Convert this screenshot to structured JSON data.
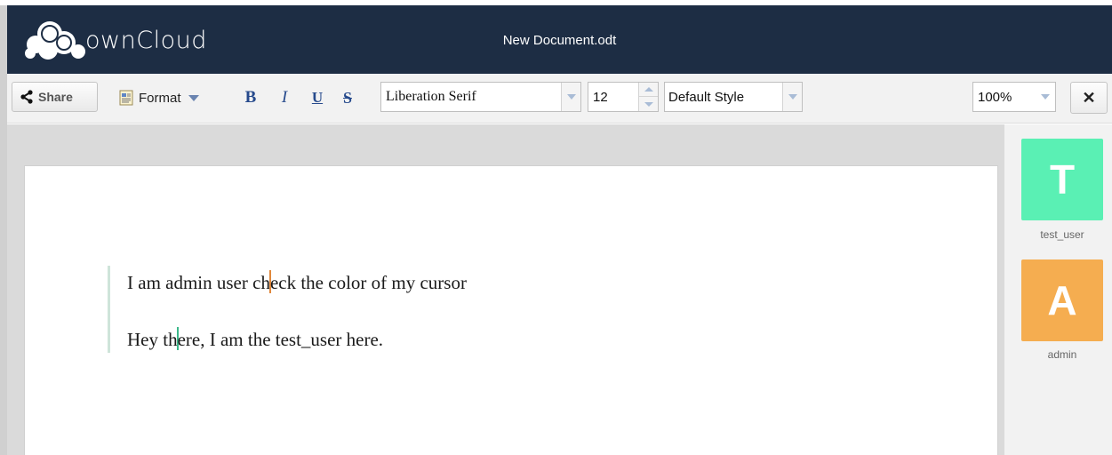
{
  "header": {
    "logo_text": "ownCloud",
    "document_title": "New Document.odt"
  },
  "toolbar": {
    "share_label": "Share",
    "format_label": "Format",
    "bold_label": "B",
    "italic_label": "I",
    "underline_label": "U",
    "strike_label": "S",
    "font_family": "Liberation Serif",
    "font_size": "12",
    "paragraph_style": "Default Style",
    "zoom": "100%",
    "close_label": "✕"
  },
  "document": {
    "paragraph_1_before": "I am admin user ch",
    "paragraph_1_after": "eck the color of my cursor",
    "paragraph_2_before": "Hey th",
    "paragraph_2_after": "ere, I am the test_user here."
  },
  "users": [
    {
      "initial": "T",
      "name": "test_user",
      "color": "#5af0b4"
    },
    {
      "initial": "A",
      "name": "admin",
      "color": "#f5ad50"
    }
  ],
  "colors": {
    "header_bg": "#1d2d44",
    "admin_cursor": "#e0883c",
    "test_user_cursor": "#3cb88a"
  }
}
